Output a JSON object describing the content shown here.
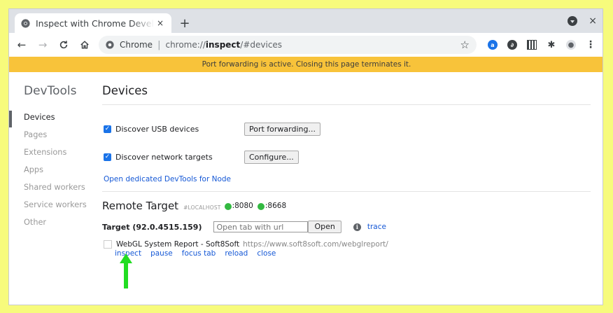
{
  "browser": {
    "tab_title": "Inspect with Chrome Developer Tools",
    "tab_close_glyph": "×",
    "new_tab_glyph": "+",
    "window_close_glyph": "×",
    "nav": {
      "back": "←",
      "forward": "→",
      "reload": "C",
      "home": "⌂"
    },
    "omnibox": {
      "site_label": "Chrome",
      "url_scheme": "chrome://",
      "url_host": "inspect",
      "url_rest": "/#devices",
      "star_glyph": "☆"
    },
    "extensions": [
      "a",
      "∂",
      "",
      "✱",
      "●",
      "⋮"
    ]
  },
  "infobar": {
    "text": "Port forwarding is active. Closing this page terminates it.",
    "color": "#f8c33a"
  },
  "sidebar": {
    "title": "DevTools",
    "items": [
      {
        "label": "Devices",
        "selected": true
      },
      {
        "label": "Pages"
      },
      {
        "label": "Extensions"
      },
      {
        "label": "Apps"
      },
      {
        "label": "Shared workers"
      },
      {
        "label": "Service workers"
      },
      {
        "label": "Other"
      }
    ]
  },
  "main": {
    "heading": "Devices",
    "usb": {
      "label": "Discover USB devices",
      "checked": true,
      "button": "Port forwarding..."
    },
    "network": {
      "label": "Discover network targets",
      "checked": true,
      "button": "Configure..."
    },
    "node_link": "Open dedicated DevTools for Node",
    "remote": {
      "title": "Remote Target",
      "host": "#LOCALHOST",
      "ports": [
        ":8080",
        ":8668"
      ]
    },
    "target": {
      "label": "Target (92.0.4515.159)",
      "input_placeholder": "Open tab with url",
      "open_button": "Open",
      "info_glyph": "i",
      "trace_link": "trace"
    },
    "page": {
      "name": "WebGL System Report - Soft8Soft",
      "url": "https://www.soft8soft.com/webglreport/",
      "actions": [
        "inspect",
        "pause",
        "focus tab",
        "reload",
        "close"
      ]
    }
  },
  "colors": {
    "page_background": "#f7fb7c",
    "link": "#1558d6",
    "port_dot": "#33b941",
    "annotation_arrow": "#22dd22"
  }
}
